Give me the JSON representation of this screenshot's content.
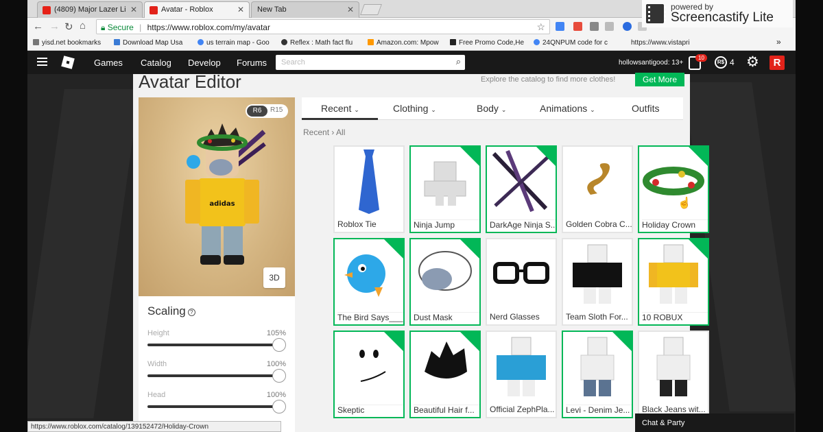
{
  "browser": {
    "tabs": [
      {
        "title": "(4809) Major Lazer Li",
        "fav_color": "#e62117"
      },
      {
        "title": "Avatar - Roblox",
        "fav_color": "#e2231a"
      },
      {
        "title": "New Tab",
        "fav_color": ""
      }
    ],
    "secure_label": "Secure",
    "url": "https://www.roblox.com/my/avatar",
    "bookmarks": [
      "yisd.net bookmarks",
      "Download Map Usa",
      "us terrain map - Goo",
      "Reflex : Math fact flu",
      "Amazon.com: Mpow",
      "Free Promo Code,He",
      "24QNPUM code for c",
      "https://www.vistapri"
    ],
    "bookmarks_more": "»"
  },
  "overlay": {
    "powered_by": "powered by",
    "brand": "Screencastify Lite"
  },
  "roblox_nav": {
    "links": [
      "Games",
      "Catalog",
      "Develop",
      "Forums"
    ],
    "search_placeholder": "Search",
    "username": "hollowsantigood: 13+",
    "messages_badge": "10",
    "robux_symbol": "R$",
    "robux_count": "4"
  },
  "page": {
    "title": "Avatar Editor",
    "promo_text": "Explore the catalog to find more clothes!",
    "get_more_label": "Get More"
  },
  "preview": {
    "rig_options": [
      "R6",
      "R15"
    ],
    "active_rig": "R6",
    "view_button": "3D"
  },
  "scaling": {
    "title": "Scaling",
    "help_symbol": "?",
    "sliders": [
      {
        "label": "Height",
        "value": "105%",
        "level": 1.0
      },
      {
        "label": "Width",
        "value": "100%",
        "level": 1.0
      },
      {
        "label": "Head",
        "value": "100%",
        "level": 1.0
      }
    ]
  },
  "catalog": {
    "tabs": [
      {
        "label": "Recent",
        "dropdown": true
      },
      {
        "label": "Clothing",
        "dropdown": true
      },
      {
        "label": "Body",
        "dropdown": true
      },
      {
        "label": "Animations",
        "dropdown": true
      },
      {
        "label": "Outfits",
        "dropdown": false
      }
    ],
    "active_tab": "Recent",
    "breadcrumb": [
      "Recent",
      "All"
    ],
    "items": [
      {
        "name": "Roblox Tie",
        "selected": false
      },
      {
        "name": "Ninja Jump",
        "selected": true
      },
      {
        "name": "DarkAge Ninja S...",
        "selected": true
      },
      {
        "name": "Golden Cobra C...",
        "selected": false
      },
      {
        "name": "Holiday Crown",
        "selected": true
      },
      {
        "name": "The Bird Says___",
        "selected": true
      },
      {
        "name": "Dust Mask",
        "selected": true
      },
      {
        "name": "Nerd Glasses",
        "selected": false
      },
      {
        "name": "Team Sloth For...",
        "selected": false
      },
      {
        "name": "10 ROBUX",
        "selected": true
      },
      {
        "name": "Skeptic",
        "selected": true
      },
      {
        "name": "Beautiful Hair f...",
        "selected": true
      },
      {
        "name": "Official ZephPla...",
        "selected": false
      },
      {
        "name": "Levi - Denim Je...",
        "selected": true
      },
      {
        "name": "Black Jeans wit...",
        "selected": false
      }
    ]
  },
  "status_url": "https://www.roblox.com/catalog/139152472/Holiday-Crown",
  "chat_label": "Chat & Party"
}
